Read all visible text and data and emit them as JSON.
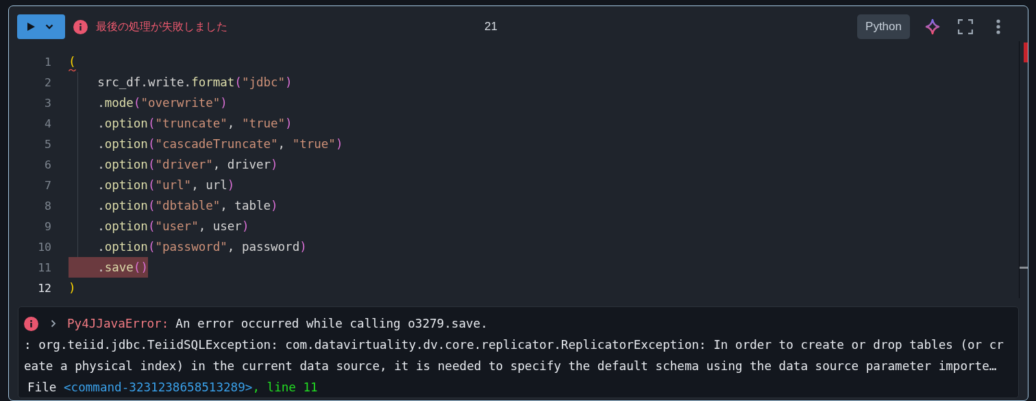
{
  "toolbar": {
    "status_message": "最後の処理が失敗しました",
    "execution_count": "21",
    "language": "Python"
  },
  "code_lines": [
    {
      "number": "1",
      "current": false,
      "highlighted": false,
      "squiggle": true,
      "tokens": [
        {
          "kind": "paren1",
          "text": "("
        }
      ]
    },
    {
      "number": "2",
      "current": false,
      "highlighted": false,
      "squiggle": false,
      "tokens": [
        {
          "kind": "plain",
          "text": "    src_df.write."
        },
        {
          "kind": "method",
          "text": "format"
        },
        {
          "kind": "paren2",
          "text": "("
        },
        {
          "kind": "string",
          "text": "\"jdbc\""
        },
        {
          "kind": "paren2",
          "text": ")"
        }
      ]
    },
    {
      "number": "3",
      "current": false,
      "highlighted": false,
      "squiggle": false,
      "tokens": [
        {
          "kind": "plain",
          "text": "    ."
        },
        {
          "kind": "method",
          "text": "mode"
        },
        {
          "kind": "paren2",
          "text": "("
        },
        {
          "kind": "string",
          "text": "\"overwrite\""
        },
        {
          "kind": "paren2",
          "text": ")"
        }
      ]
    },
    {
      "number": "4",
      "current": false,
      "highlighted": false,
      "squiggle": false,
      "tokens": [
        {
          "kind": "plain",
          "text": "    ."
        },
        {
          "kind": "method",
          "text": "option"
        },
        {
          "kind": "paren2",
          "text": "("
        },
        {
          "kind": "string",
          "text": "\"truncate\""
        },
        {
          "kind": "plain",
          "text": ", "
        },
        {
          "kind": "string",
          "text": "\"true\""
        },
        {
          "kind": "paren2",
          "text": ")"
        }
      ]
    },
    {
      "number": "5",
      "current": false,
      "highlighted": false,
      "squiggle": false,
      "tokens": [
        {
          "kind": "plain",
          "text": "    ."
        },
        {
          "kind": "method",
          "text": "option"
        },
        {
          "kind": "paren2",
          "text": "("
        },
        {
          "kind": "string",
          "text": "\"cascadeTruncate\""
        },
        {
          "kind": "plain",
          "text": ", "
        },
        {
          "kind": "string",
          "text": "\"true\""
        },
        {
          "kind": "paren2",
          "text": ")"
        }
      ]
    },
    {
      "number": "6",
      "current": false,
      "highlighted": false,
      "squiggle": false,
      "tokens": [
        {
          "kind": "plain",
          "text": "    ."
        },
        {
          "kind": "method",
          "text": "option"
        },
        {
          "kind": "paren2",
          "text": "("
        },
        {
          "kind": "string",
          "text": "\"driver\""
        },
        {
          "kind": "plain",
          "text": ", driver"
        },
        {
          "kind": "paren2",
          "text": ")"
        }
      ]
    },
    {
      "number": "7",
      "current": false,
      "highlighted": false,
      "squiggle": false,
      "tokens": [
        {
          "kind": "plain",
          "text": "    ."
        },
        {
          "kind": "method",
          "text": "option"
        },
        {
          "kind": "paren2",
          "text": "("
        },
        {
          "kind": "string",
          "text": "\"url\""
        },
        {
          "kind": "plain",
          "text": ", url"
        },
        {
          "kind": "paren2",
          "text": ")"
        }
      ]
    },
    {
      "number": "8",
      "current": false,
      "highlighted": false,
      "squiggle": false,
      "tokens": [
        {
          "kind": "plain",
          "text": "    ."
        },
        {
          "kind": "method",
          "text": "option"
        },
        {
          "kind": "paren2",
          "text": "("
        },
        {
          "kind": "string",
          "text": "\"dbtable\""
        },
        {
          "kind": "plain",
          "text": ", table"
        },
        {
          "kind": "paren2",
          "text": ")"
        }
      ]
    },
    {
      "number": "9",
      "current": false,
      "highlighted": false,
      "squiggle": false,
      "tokens": [
        {
          "kind": "plain",
          "text": "    ."
        },
        {
          "kind": "method",
          "text": "option"
        },
        {
          "kind": "paren2",
          "text": "("
        },
        {
          "kind": "string",
          "text": "\"user\""
        },
        {
          "kind": "plain",
          "text": ", user"
        },
        {
          "kind": "paren2",
          "text": ")"
        }
      ]
    },
    {
      "number": "10",
      "current": false,
      "highlighted": false,
      "squiggle": false,
      "tokens": [
        {
          "kind": "plain",
          "text": "    ."
        },
        {
          "kind": "method",
          "text": "option"
        },
        {
          "kind": "paren2",
          "text": "("
        },
        {
          "kind": "string",
          "text": "\"password\""
        },
        {
          "kind": "plain",
          "text": ", password"
        },
        {
          "kind": "paren2",
          "text": ")"
        }
      ]
    },
    {
      "number": "11",
      "current": false,
      "highlighted": true,
      "squiggle": false,
      "tokens": [
        {
          "kind": "plain",
          "text": "    ."
        },
        {
          "kind": "method",
          "text": "save"
        },
        {
          "kind": "paren2",
          "text": "()"
        }
      ]
    },
    {
      "number": "12",
      "current": true,
      "highlighted": false,
      "squiggle": false,
      "tokens": [
        {
          "kind": "paren1",
          "text": ")"
        }
      ]
    }
  ],
  "output": {
    "expanded": false,
    "error_name": "Py4JJavaError:",
    "error_message": "An error occurred while calling o3279.save.",
    "detail": ": org.teiid.jdbc.TeiidSQLException: com.datavirtuality.dv.core.replicator.ReplicatorException: In order to create or drop tables (or create a physical index) in the current data source, it is needed to specify the default schema using the data source parameter importe…",
    "traceback": [
      {
        "kind": "plain",
        "text": "File"
      },
      {
        "kind": "link",
        "text": "<command-3231238658513289>"
      },
      {
        "kind": "lineref",
        "text": ", line 11"
      }
    ]
  }
}
